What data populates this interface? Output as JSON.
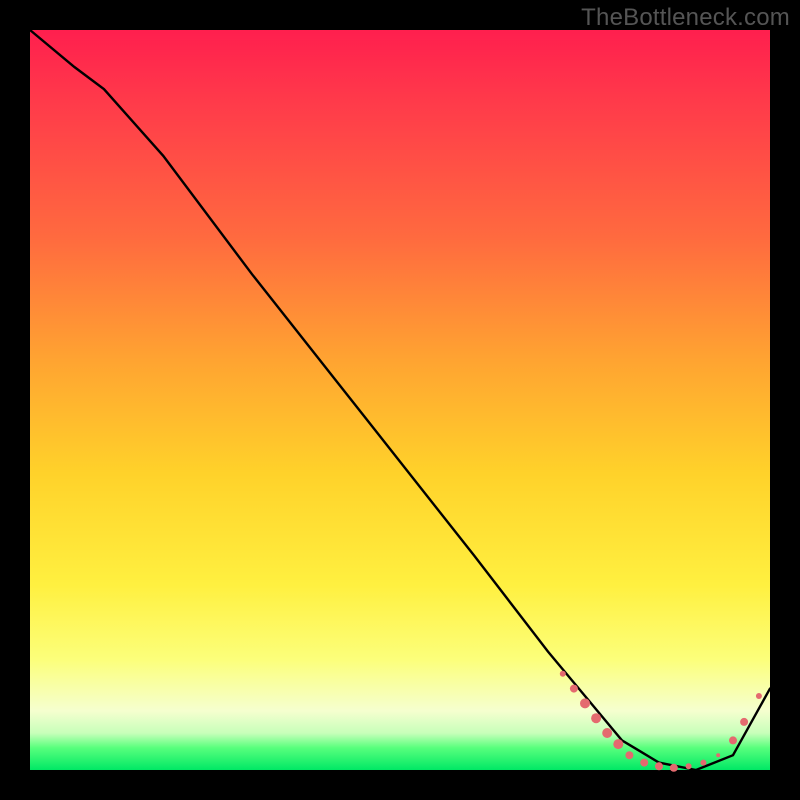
{
  "watermark": "TheBottleneck.com",
  "chart_data": {
    "type": "line",
    "title": "",
    "xlabel": "",
    "ylabel": "",
    "xlim": [
      0,
      100
    ],
    "ylim": [
      0,
      100
    ],
    "series": [
      {
        "name": "bottleneck-curve",
        "x": [
          0,
          6,
          10,
          18,
          30,
          45,
          60,
          70,
          75,
          80,
          85,
          90,
          95,
          100
        ],
        "y": [
          100,
          95,
          92,
          83,
          67,
          48,
          29,
          16,
          10,
          4,
          1,
          0,
          2,
          11
        ]
      }
    ],
    "markers": {
      "name": "highlight-dots",
      "color": "#e46a6f",
      "points": [
        {
          "x": 72,
          "y": 13,
          "r": 3
        },
        {
          "x": 73.5,
          "y": 11,
          "r": 4
        },
        {
          "x": 75,
          "y": 9,
          "r": 5
        },
        {
          "x": 76.5,
          "y": 7,
          "r": 5
        },
        {
          "x": 78,
          "y": 5,
          "r": 5
        },
        {
          "x": 79.5,
          "y": 3.5,
          "r": 5
        },
        {
          "x": 81,
          "y": 2,
          "r": 4
        },
        {
          "x": 83,
          "y": 1,
          "r": 4
        },
        {
          "x": 85,
          "y": 0.5,
          "r": 4
        },
        {
          "x": 87,
          "y": 0.3,
          "r": 4
        },
        {
          "x": 89,
          "y": 0.5,
          "r": 3
        },
        {
          "x": 91,
          "y": 1,
          "r": 3
        },
        {
          "x": 93,
          "y": 2,
          "r": 2
        },
        {
          "x": 95,
          "y": 4,
          "r": 4
        },
        {
          "x": 96.5,
          "y": 6.5,
          "r": 4
        },
        {
          "x": 98.5,
          "y": 10,
          "r": 3
        }
      ]
    },
    "gradient_stops": [
      {
        "pos": 0,
        "color": "#ff1f4e"
      },
      {
        "pos": 10,
        "color": "#ff3b4a"
      },
      {
        "pos": 28,
        "color": "#ff6a3f"
      },
      {
        "pos": 45,
        "color": "#ffa531"
      },
      {
        "pos": 60,
        "color": "#ffd22a"
      },
      {
        "pos": 75,
        "color": "#fff040"
      },
      {
        "pos": 85,
        "color": "#fcff7a"
      },
      {
        "pos": 92,
        "color": "#f5ffcf"
      },
      {
        "pos": 95,
        "color": "#c8ffba"
      },
      {
        "pos": 97,
        "color": "#58ff7d"
      },
      {
        "pos": 100,
        "color": "#00e865"
      }
    ]
  }
}
